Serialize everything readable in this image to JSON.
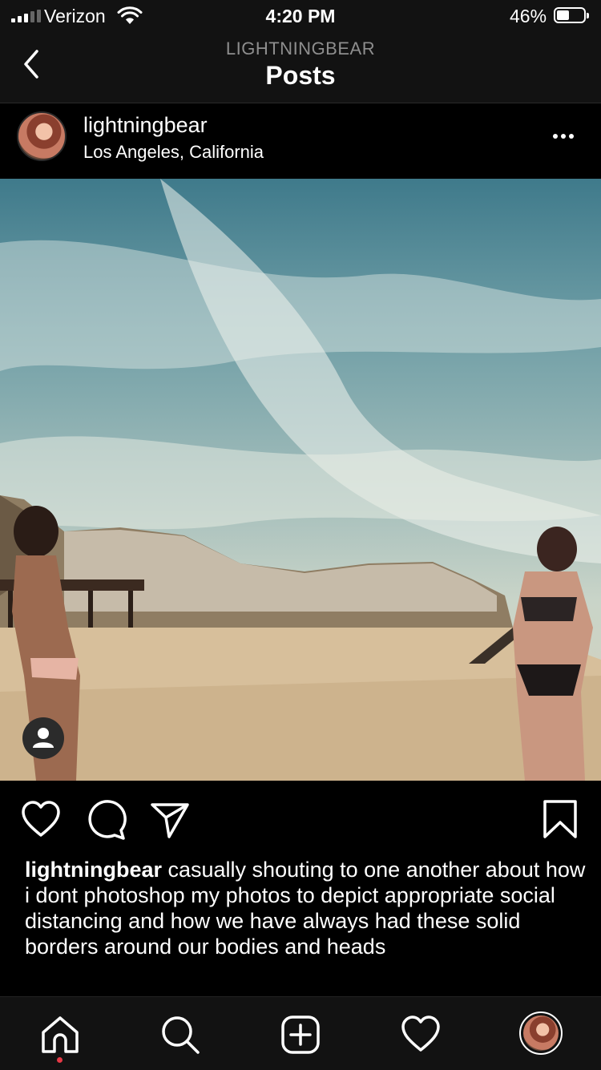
{
  "status": {
    "carrier": "Verizon",
    "time": "4:20 PM",
    "battery_percent": "46%",
    "battery_level": 0.46
  },
  "header": {
    "username": "LIGHTNINGBEAR",
    "title": "Posts"
  },
  "post": {
    "author": "lightningbear",
    "location": "Los Angeles, California",
    "caption_user": "lightningbear",
    "caption_text": " casually shouting to one another about how i dont photoshop my photos to depict appropriate social distancing and how we have always had these solid borders around our bodies and heads"
  },
  "icons": {
    "back": "chevron-left-icon",
    "more": "more-horizontal-icon",
    "like": "heart-icon",
    "comment": "comment-icon",
    "share": "send-icon",
    "save": "bookmark-icon",
    "tag": "person-icon",
    "home": "home-icon",
    "search": "search-icon",
    "new_post": "plus-square-icon",
    "activity": "heart-icon",
    "profile": "avatar"
  },
  "colors": {
    "background": "#000000",
    "bar_background": "#121212",
    "secondary_text": "#8e8e8e",
    "notification_dot": "#e63946"
  }
}
